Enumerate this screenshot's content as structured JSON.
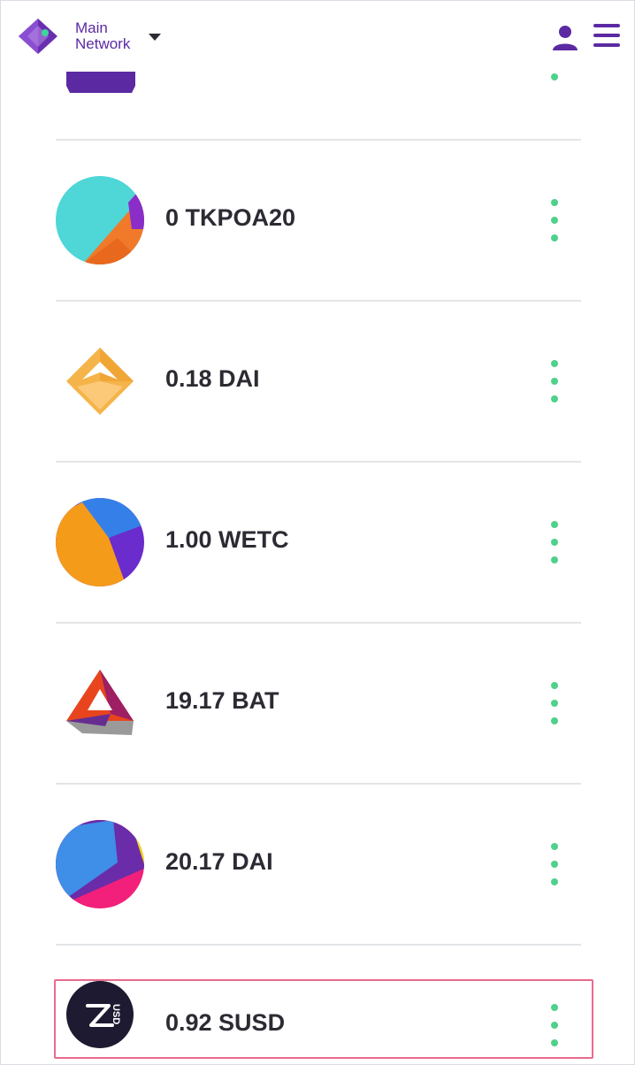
{
  "header": {
    "network_line1": "Main",
    "network_line2": "Network",
    "logo_icon": "wallet-logo-icon",
    "caret_icon": "chevron-down-icon",
    "user_icon": "user-icon",
    "menu_icon": "hamburger-menu-icon"
  },
  "colors": {
    "brand": "#5b2aa3",
    "accent_dots": "#4fd18b",
    "text": "#2b2b33",
    "divider": "#e3e5e8",
    "highlight_border": "#ea6a8d"
  },
  "tokens": [
    {
      "label": "0 TKPOA20",
      "icon": "tkpoa20-token-icon"
    },
    {
      "label": "0.18 DAI",
      "icon": "dai-token-icon"
    },
    {
      "label": "1.00 WETC",
      "icon": "wetc-token-icon"
    },
    {
      "label": "19.17 BAT",
      "icon": "bat-token-icon"
    },
    {
      "label": "20.17 DAI",
      "icon": "dai-identicon-token-icon"
    },
    {
      "label": "0.92 SUSD",
      "icon": "susd-token-icon",
      "icon_text": "USD",
      "highlighted": true
    }
  ]
}
